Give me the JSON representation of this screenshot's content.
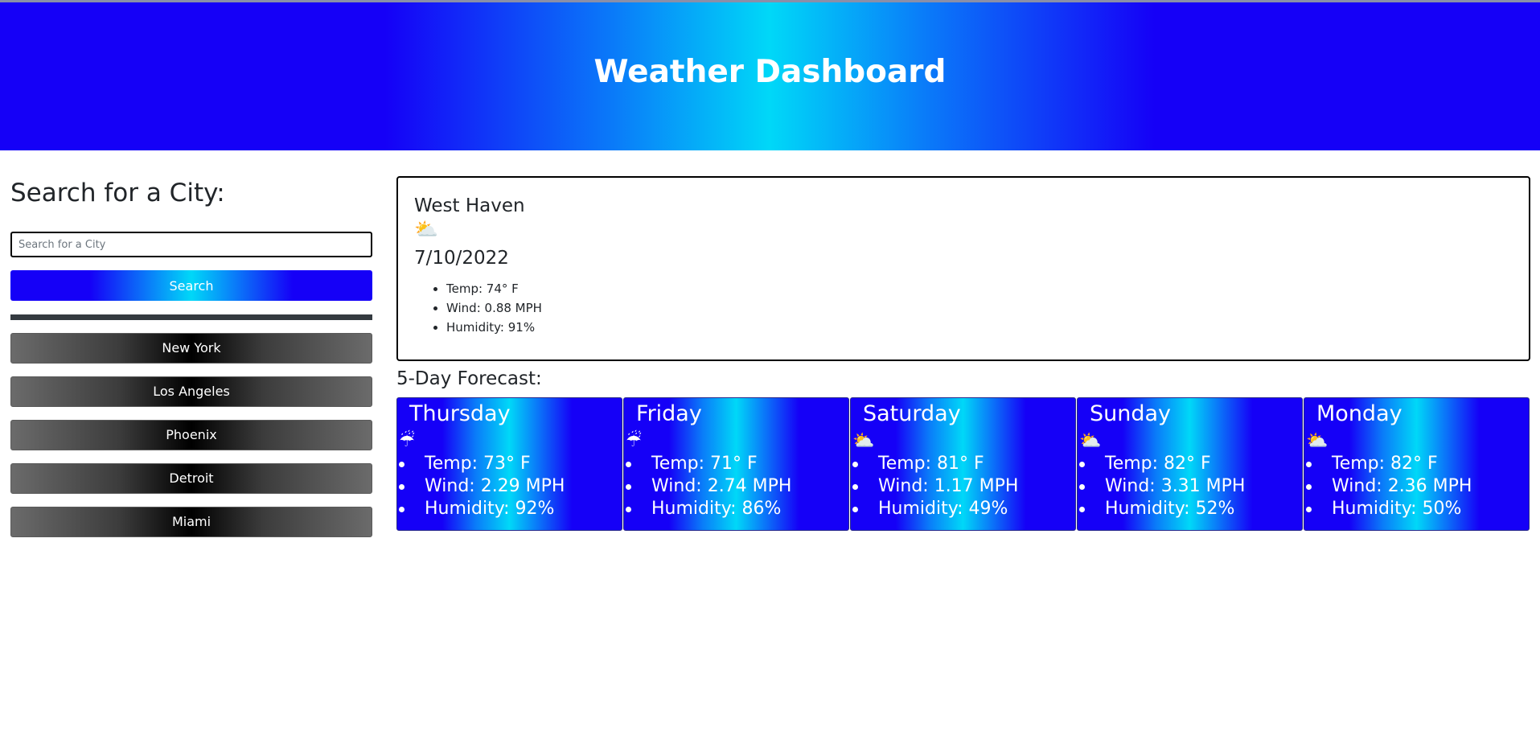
{
  "header": {
    "title": "Weather Dashboard"
  },
  "colors": {
    "accent_blue": "#1500f7",
    "accent_cyan": "#00d8f8",
    "dark_button": "#000000"
  },
  "sidebar": {
    "heading": "Search for a City:",
    "search_placeholder": "Search for a City",
    "search_value": "",
    "search_button": "Search",
    "history": [
      "New York",
      "Los Angeles",
      "Phoenix",
      "Detroit",
      "Miami"
    ]
  },
  "current": {
    "city": "West Haven",
    "icon": "partly-cloudy-icon",
    "date": "7/10/2022",
    "temp": "Temp: 74° F",
    "wind": "Wind: 0.88 MPH",
    "humidity": "Humidity: 91%"
  },
  "forecast": {
    "title": "5-Day Forecast:",
    "days": [
      {
        "day": "Thursday",
        "icon": "rain-umbrella-icon",
        "temp": "Temp: 73° F",
        "wind": "Wind: 2.29 MPH",
        "humidity": "Humidity: 92%"
      },
      {
        "day": "Friday",
        "icon": "rain-umbrella-icon",
        "temp": "Temp: 71° F",
        "wind": "Wind: 2.74 MPH",
        "humidity": "Humidity: 86%"
      },
      {
        "day": "Saturday",
        "icon": "partly-cloudy-icon",
        "temp": "Temp: 81° F",
        "wind": "Wind: 1.17 MPH",
        "humidity": "Humidity: 49%"
      },
      {
        "day": "Sunday",
        "icon": "partly-cloudy-icon",
        "temp": "Temp: 82° F",
        "wind": "Wind: 3.31 MPH",
        "humidity": "Humidity: 52%"
      },
      {
        "day": "Monday",
        "icon": "partly-cloudy-icon",
        "temp": "Temp: 82° F",
        "wind": "Wind: 2.36 MPH",
        "humidity": "Humidity: 50%"
      }
    ]
  }
}
